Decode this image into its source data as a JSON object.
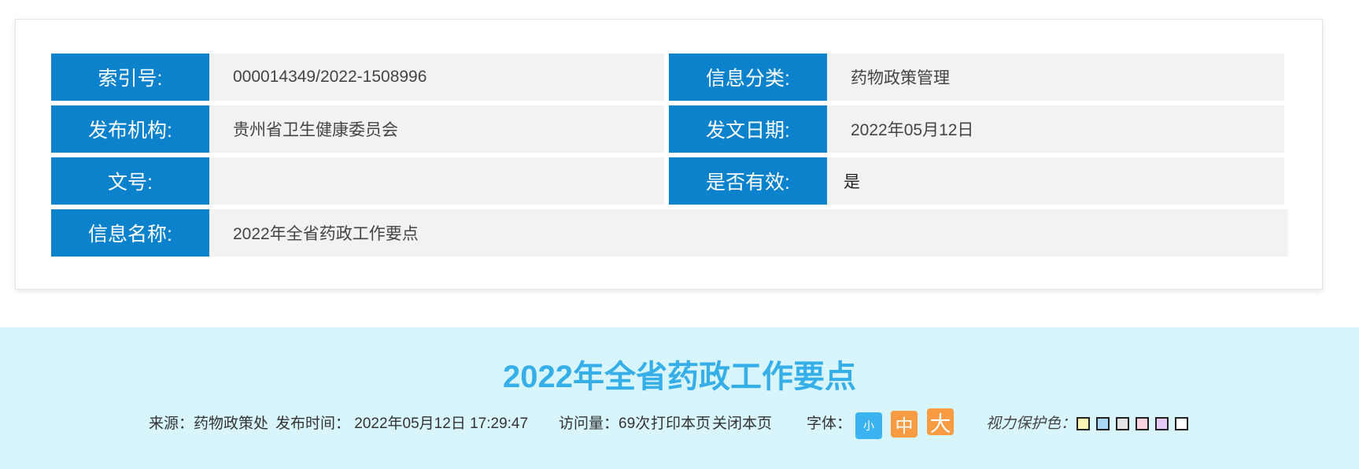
{
  "info_table": {
    "index_label": "索引号:",
    "index_value": "000014349/2022-1508996",
    "category_label": "信息分类:",
    "category_value": "药物政策管理",
    "publisher_label": "发布机构:",
    "publisher_value": "贵州省卫生健康委员会",
    "date_label": "发文日期:",
    "date_value": "2022年05月12日",
    "doc_no_label": "文号:",
    "doc_no_value": "",
    "valid_label": "是否有效:",
    "valid_value": "是",
    "name_label": "信息名称:",
    "name_value": "2022年全省药政工作要点"
  },
  "article": {
    "title": "2022年全省药政工作要点",
    "source": "来源：药物政策处",
    "publish_time": "发布时间： 2022年05月12日 17:29:47",
    "views": "访问量：69次",
    "print_link": "打印本页",
    "close_link": "关闭本页",
    "font_label": "字体：",
    "font_small": "小",
    "font_medium": "中",
    "font_large": "大",
    "eye_label": "视力保护色："
  },
  "colors": {
    "label_bg": "#0b82cb",
    "value_bg": "#f2f2f2",
    "title_band_bg": "#d7f5fb",
    "title_color": "#36aee8",
    "font_small_bg": "#3bb3f0",
    "font_medium_large_bg": "#f89b42"
  },
  "eye_swatches": [
    "#faf5b4",
    "#a9d6f5",
    "#e3e3e3",
    "#f7d3dd",
    "#e5caf5",
    "#ffffff"
  ]
}
